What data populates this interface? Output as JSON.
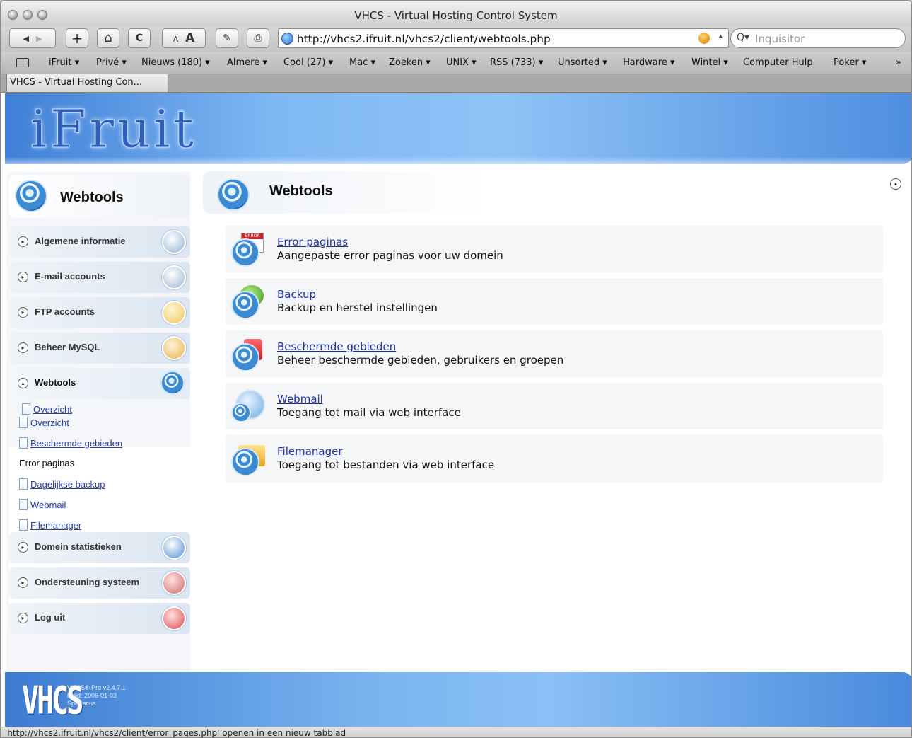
{
  "window": {
    "title": "VHCS - Virtual Hosting Control System"
  },
  "toolbar": {
    "back_glyph": "◀",
    "forward_glyph": "▶",
    "add_glyph": "+",
    "home_glyph": "⌂",
    "reload_glyph": "C",
    "font_small": "A",
    "font_large": "A",
    "edit_glyph": "✎",
    "print_glyph": "⎙",
    "url": "http://vhcs2.ifruit.nl/vhcs2/client/webtools.php",
    "search_placeholder": "Inquisitor",
    "search_glyph": "Q▾"
  },
  "bookmarks": [
    "iFruit ▾",
    "Privé ▾",
    "Nieuws (180) ▾",
    "Almere ▾",
    "Cool (27) ▾",
    "Mac ▾",
    "Zoeken ▾",
    "UNIX ▾",
    "RSS (733) ▾",
    "Unsorted ▾",
    "Hardware ▾",
    "Wintel ▾",
    "Computer Hulp",
    "Poker ▾",
    "»"
  ],
  "tab": {
    "label": "VHCS - Virtual Hosting Con..."
  },
  "banner": {
    "logo_text": "iFruit"
  },
  "sidebar": {
    "title": "Webtools",
    "menu": [
      {
        "label": "Algemene informatie",
        "icon": "info-icon",
        "color": "#8fb3d6"
      },
      {
        "label": "E-mail accounts",
        "icon": "envelope-icon",
        "color": "#9fb6cf"
      },
      {
        "label": "FTP accounts",
        "icon": "folder-icon",
        "color": "#f0c65a"
      },
      {
        "label": "Beheer MySQL",
        "icon": "database-icon",
        "color": "#e9b24f"
      },
      {
        "label": "Webtools",
        "icon": "gear-icon",
        "color": "#3c8ad1"
      },
      {
        "label": "Domein statistieken",
        "icon": "stats-icon",
        "color": "#4f8fd3"
      },
      {
        "label": "Ondersteuning systeem",
        "icon": "support-icon",
        "color": "#d06b6b"
      },
      {
        "label": "Log uit",
        "icon": "power-icon",
        "color": "#e04a4a"
      }
    ],
    "submenu": [
      {
        "label": "Overzicht",
        "link": true
      },
      {
        "label": "Beschermde gebieden",
        "link": true
      },
      {
        "label": "Error paginas",
        "link": false
      },
      {
        "label": "Dagelijkse backup",
        "link": true
      },
      {
        "label": "Webmail",
        "link": true
      },
      {
        "label": "Filemanager",
        "link": true
      }
    ]
  },
  "main": {
    "title": "Webtools",
    "tools": [
      {
        "title": "Error paginas",
        "desc": "Aangepaste error paginas voor uw domein",
        "icon": "error-page-icon"
      },
      {
        "title": "Backup",
        "desc": "Backup en herstel instellingen",
        "icon": "backup-icon"
      },
      {
        "title": "Beschermde gebieden",
        "desc": "Beheer beschermde gebieden, gebruikers en groepen",
        "icon": "lock-icon"
      },
      {
        "title": "Webmail",
        "desc": "Toegang tot mail via web interface",
        "icon": "webmail-icon"
      },
      {
        "title": "Filemanager",
        "desc": "Toegang tot bestanden via web interface",
        "icon": "filemanager-icon"
      }
    ]
  },
  "footer": {
    "logo": "VHCS",
    "product": "VHCS® Pro v2.4.7.1",
    "build": "build: 2006-01-03",
    "codename": "Spartacus"
  },
  "status": {
    "text": "'http://vhcs2.ifruit.nl/vhcs2/client/error_pages.php' openen in een nieuw tabblad"
  }
}
